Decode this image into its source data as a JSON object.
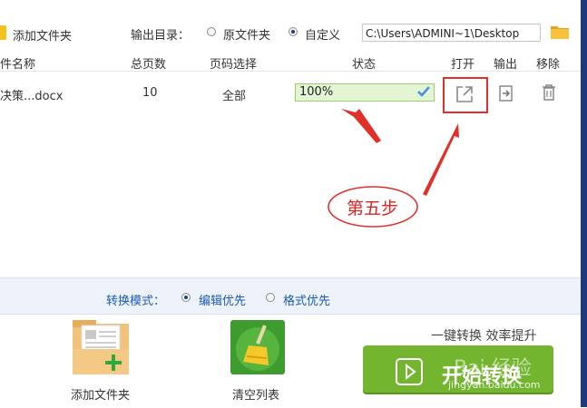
{
  "toolbar": {
    "add_folder": "添加文件夹",
    "output_dir": "输出目录：",
    "radio_source": "原文件夹",
    "radio_custom": "自定义",
    "path": "C:\\Users\\ADMINI~1\\Desktop"
  },
  "table": {
    "headers": {
      "filename": "件名称",
      "pages": "总页数",
      "page_select": "页码选择",
      "status": "状态",
      "open": "打开",
      "export": "输出",
      "remove": "移除"
    },
    "rows": [
      {
        "filename": "决策...docx",
        "pages": "10",
        "page_select": "全部",
        "progress_text": "100%",
        "progress": 1.0
      }
    ]
  },
  "annotation": {
    "step": "第五步",
    "color": "#d92525"
  },
  "mode": {
    "label": "转换模式：",
    "edit": "编辑优先",
    "format": "格式优先"
  },
  "bottom": {
    "add_folder": "添加文件夹",
    "clear": "清空列表",
    "slogan": "一键转换  效率提升",
    "start": "开始转换",
    "watermark": "Bai 经验",
    "watermark_url": "jingyan.baidu.com"
  },
  "colors": {
    "accent": "#74b530",
    "mode_text": "#1b5bb5",
    "highlight": "#e0302a"
  }
}
